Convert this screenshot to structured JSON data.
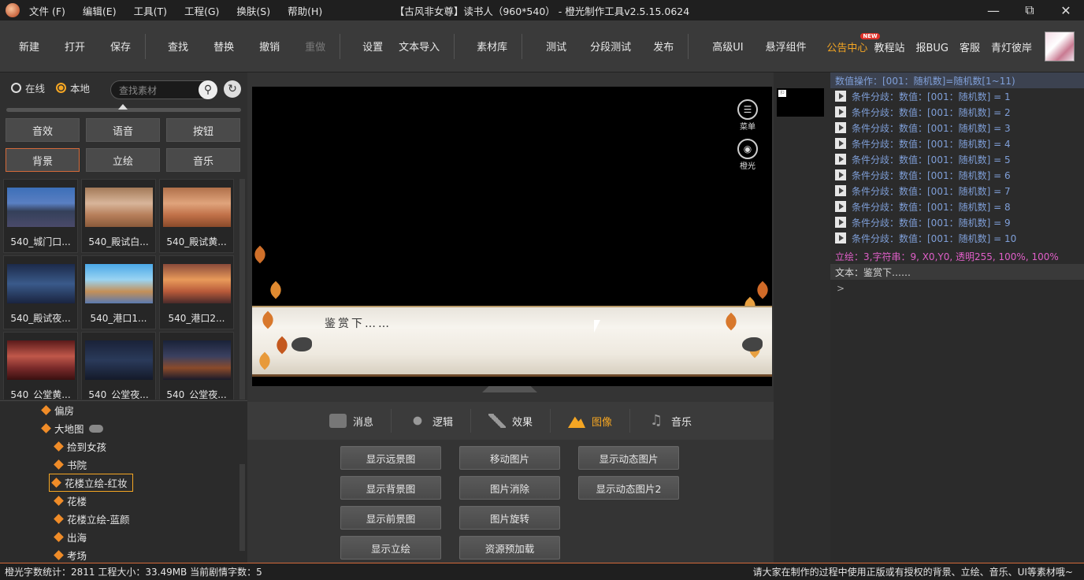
{
  "titlebar": {
    "menus": [
      "文件 (F)",
      "编辑(E)",
      "工具(T)",
      "工程(G)",
      "换肤(S)",
      "帮助(H)"
    ],
    "title": "【古风非女尊】读书人（960*540） - 橙光制作工具v2.5.15.0624"
  },
  "toolbar": {
    "groups": [
      [
        "新建",
        "打开",
        "保存"
      ],
      [
        "查找",
        "替换",
        "撤销",
        "重做"
      ],
      [
        "设置",
        "文本导入"
      ],
      [
        "素材库"
      ],
      [
        "测试",
        "分段测试",
        "发布"
      ],
      [
        "高级UI",
        "悬浮组件"
      ]
    ],
    "right": [
      "公告中心",
      "教程站",
      "报BUG",
      "客服",
      "青灯彼岸"
    ],
    "new_badge": "NEW"
  },
  "left": {
    "radio_online": "在线",
    "radio_local": "本地",
    "search_placeholder": "查找素材",
    "categories": [
      "音效",
      "语音",
      "按钮",
      "背景",
      "立绘",
      "音乐"
    ],
    "thumbs": [
      "540_城门口...",
      "540_殿试白...",
      "540_殿试黄...",
      "540_殿试夜...",
      "540_港口1...",
      "540_港口2...",
      "540_公堂黄...",
      "540_公堂夜...",
      "540_公堂夜..."
    ],
    "tree": [
      "偏房",
      "大地图",
      "捡到女孩",
      "书院",
      "花楼立绘-红妆",
      "花楼",
      "花楼立绘-蓝颜",
      "出海",
      "考场"
    ]
  },
  "stage": {
    "dialog_text": "鉴赏下……",
    "menu_label": "菜单",
    "orange_label": "橙光"
  },
  "tabs": [
    "消息",
    "逻辑",
    "效果",
    "图像",
    "音乐"
  ],
  "actions": [
    "显示远景图",
    "移动图片",
    "显示动态图片",
    "显示背景图",
    "图片消除",
    "显示动态图片2",
    "显示前景图",
    "图片旋转",
    "",
    "显示立绘",
    "资源预加载",
    ""
  ],
  "log": {
    "header": "数值操作：[001：随机数]=随机数[1~11)",
    "branches": [
      "条件分歧：数值：[001：随机数] = 1",
      "条件分歧：数值：[001：随机数] = 2",
      "条件分歧：数值：[001：随机数] = 3",
      "条件分歧：数值：[001：随机数] = 4",
      "条件分歧：数值：[001：随机数] = 5",
      "条件分歧：数值：[001：随机数] = 6",
      "条件分歧：数值：[001：随机数] = 7",
      "条件分歧：数值：[001：随机数] = 8",
      "条件分歧：数值：[001：随机数] = 9",
      "条件分歧：数值：[001：随机数] = 10"
    ],
    "portrait": "立绘：3,字符串：9, X0,Y0, 透明255, 100%, 100%",
    "text": "文本：鉴赏下……",
    "prompt": ">"
  },
  "status": {
    "left": "橙光字数统计：2811  工程大小：33.49MB  当前剧情字数：5",
    "right": "请大家在制作的过程中使用正版或有授权的背景、立绘、音乐、UI等素材哦~"
  },
  "colors": {
    "accent": "#f5a623",
    "log_text": "#7f9fd8",
    "portrait_text": "#e05fc8"
  }
}
